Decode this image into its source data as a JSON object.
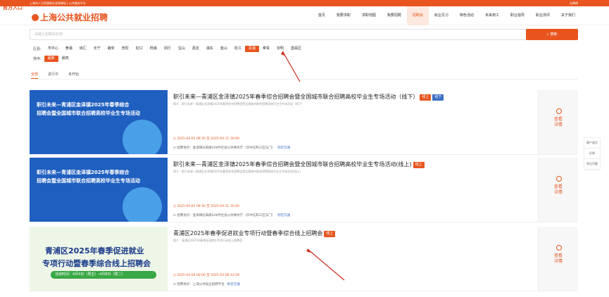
{
  "topbar": {
    "left_text": "上海市人力资源和社会保障局 | 公共服务平台",
    "right_text": "无障碍"
  },
  "corner_badge": "官方入口",
  "brand": {
    "title": "上海公共就业招聘"
  },
  "nav": [
    "首页",
    "我要求职",
    "求职地图",
    "我要招聘",
    "招聘会",
    "就业见习",
    "特色活动",
    "未来用工",
    "职业指导",
    "职业测评",
    "关于我们"
  ],
  "nav_active_index": 4,
  "search": {
    "placeholder": "请输入招聘会名称",
    "button_label": "搜索"
  },
  "filters": {
    "district_label": "区县:",
    "districts": [
      "市中心",
      "黄浦",
      "徐汇",
      "长宁",
      "静安",
      "普陀",
      "虹口",
      "杨浦",
      "闵行",
      "宝山",
      "嘉定",
      "浦东",
      "金山",
      "松江",
      "青浦",
      "奉贤",
      "崇明",
      "直属区"
    ],
    "district_active_index": 14,
    "sort_label": "排序:",
    "sorts": [
      "最新",
      "最热"
    ],
    "sort_active_index": 0
  },
  "tabs": [
    "全部",
    "进行中",
    "未开始"
  ],
  "tab_active_index": 0,
  "cards": [
    {
      "thumb_line1": "职引未来—青浦区金泽镇2025年春季综合",
      "thumb_line2": "招聘会暨全国城市联合招聘高校毕业生专场活动",
      "title": "职引未来—青浦区金泽镇2025年春季综合招聘会暨全国城市联合招聘高校毕业生专场活动（线下）",
      "tags": [
        {
          "text": "线上",
          "color": "orange"
        },
        {
          "text": "线下",
          "color": "blue"
        }
      ],
      "intro": "简介：职引未来—青浦区金泽镇2025年春季综合招聘会暨全国城市联合招聘高校毕业生专场活动（线下）",
      "time": "2025-04-01 09:30 至 2025-04-11 16:00",
      "address": "招聘地点：金泽镇北朱路428弄社会公共事务厅（华中信和三区东门）",
      "map_link": "附近交通",
      "detail": "查看详情"
    },
    {
      "thumb_line1": "职引未来—青浦区金泽镇2025年春季综合",
      "thumb_line2": "招聘会暨全国城市联合招聘高校毕业生专场活动",
      "title": "职引未来—青浦区金泽镇2025年春季综合招聘会暨全国城市联合招聘高校毕业生专场活动(线上)",
      "tags": [
        {
          "text": "线上",
          "color": "orange"
        }
      ],
      "intro": "简介：职引未来—青浦区金泽镇2025年春季综合招聘会暨全国城市联合招聘高校毕业生专场活动(线上)",
      "time": "2025-04-01 09:30 至 2025-04-31 16:00",
      "address": "招聘地点：金泽镇北朱路428弄社会公共事务厅（华中信和三区东门）",
      "map_link": "附近交通",
      "detail": "查看详情"
    },
    {
      "thumb_line1": "青浦区2025年春季促进就业",
      "thumb_line2": "专项行动暨春季综合线上招聘会",
      "thumb_line3": "活动时间：4月4日（周五）-4月8日（周二）",
      "title": "青浦区2025年春季促进就业专项行动暨春季综合线上招聘会",
      "tags": [
        {
          "text": "线上",
          "color": "orange"
        }
      ],
      "intro": "简介：青浦区2025年春季促进就业专项行动线上招聘会",
      "time": "2025-04-04 00:00 至 2025-04-08 23:59",
      "address": "招聘地点：上海公共就业招聘平台",
      "map_link": "附近交通",
      "detail": "查看详情"
    }
  ],
  "side_widget": [
    "客户留言",
    "反馈",
    "常见问题"
  ],
  "colors": {
    "brand": "#e8551e",
    "tag_blue": "#3a6fc4",
    "thumb_blue": "#1f5fbf",
    "thumb_green": "#39a845"
  }
}
